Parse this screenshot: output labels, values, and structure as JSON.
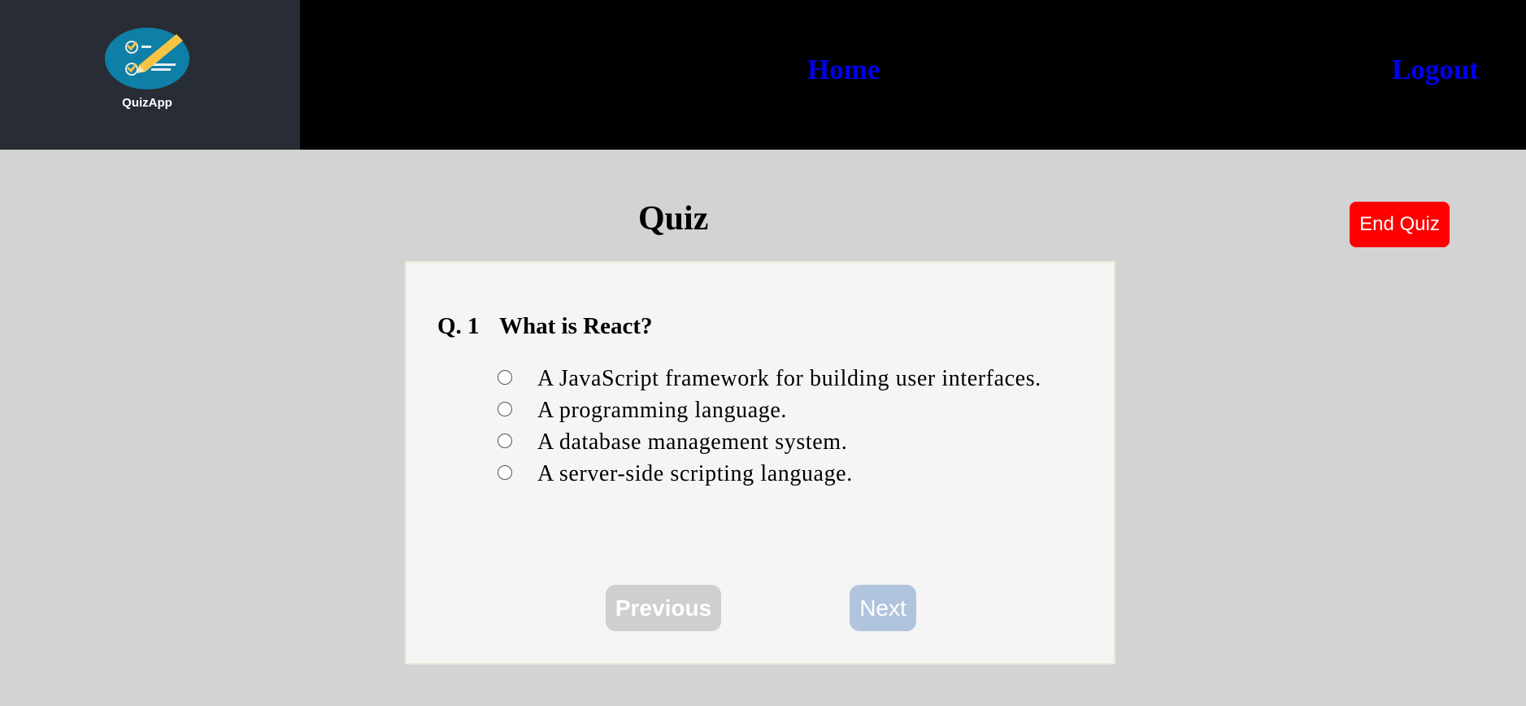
{
  "header": {
    "logo_text": "QuizApp",
    "nav": {
      "home_label": "Home",
      "logout_label": "Logout"
    }
  },
  "page": {
    "title": "Quiz",
    "end_quiz_label": "End Quiz"
  },
  "quiz": {
    "question_number": "Q. 1",
    "question_text": "What is React?",
    "options": [
      "A JavaScript framework for building user interfaces.",
      "A programming language.",
      "A database management system.",
      "A server-side scripting language."
    ],
    "previous_label": "Previous",
    "next_label": "Next"
  },
  "colors": {
    "header_bg": "#000000",
    "logo_bg": "#282c34",
    "page_bg": "#d3d3d3",
    "nav_link": "#0000ee",
    "end_quiz": "#ff0000",
    "previous_disabled": "#cfcfcf",
    "next_button": "#b0c4de"
  }
}
